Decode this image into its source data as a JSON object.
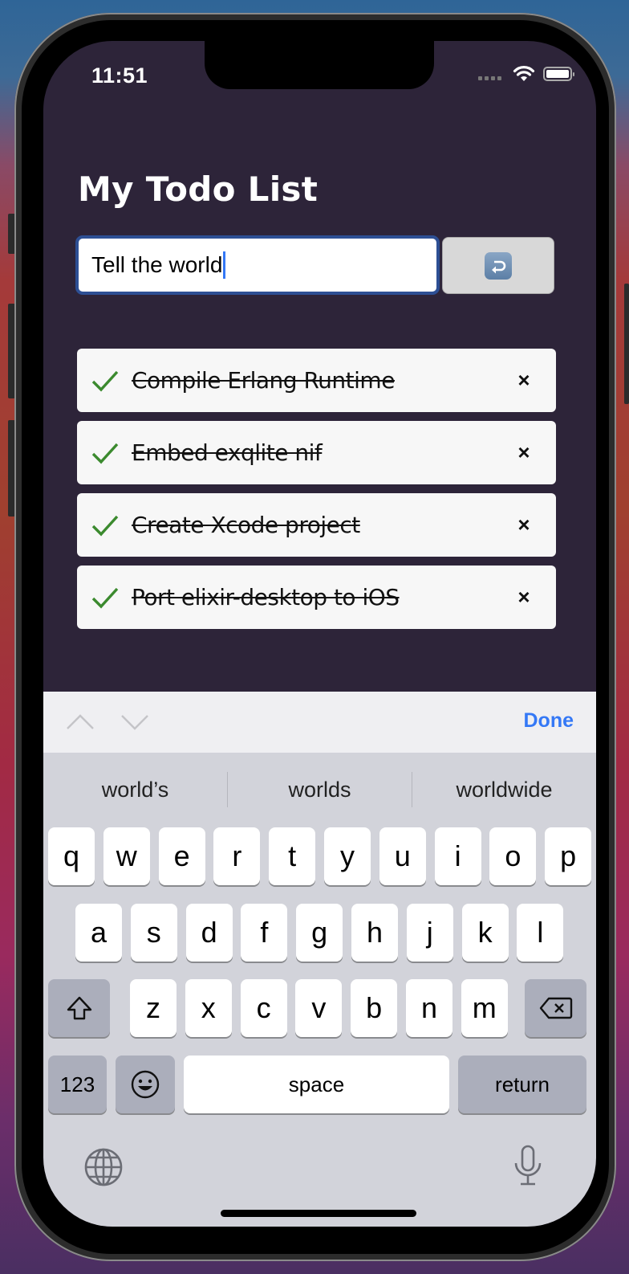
{
  "status_bar": {
    "time": "11:51",
    "icons": [
      "signal-dots-icon",
      "wifi-icon",
      "battery-icon"
    ]
  },
  "app": {
    "title": "My Todo List",
    "input": {
      "value": "Tell the world",
      "placeholder": ""
    },
    "submit_button": {
      "icon": "return-arrow-icon",
      "icon_glyph": "↩"
    },
    "todos": [
      {
        "text": "Compile Erlang Runtime",
        "done": true,
        "delete_glyph": "×"
      },
      {
        "text": "Embed exqlite nif",
        "done": true,
        "delete_glyph": "×"
      },
      {
        "text": "Create Xcode project",
        "done": true,
        "delete_glyph": "×"
      },
      {
        "text": "Port elixir-desktop to iOS",
        "done": true,
        "delete_glyph": "×"
      }
    ],
    "colors": {
      "background": "#2d2439",
      "check": "#3b8a2e",
      "input_border": "#2d4f94",
      "accent": "#3478f6"
    }
  },
  "keyboard_toolbar": {
    "done_label": "Done"
  },
  "keyboard": {
    "suggestions": [
      "world’s",
      "worlds",
      "worldwide"
    ],
    "row1": [
      "q",
      "w",
      "e",
      "r",
      "t",
      "y",
      "u",
      "i",
      "o",
      "p"
    ],
    "row2": [
      "a",
      "s",
      "d",
      "f",
      "g",
      "h",
      "j",
      "k",
      "l"
    ],
    "row3": [
      "z",
      "x",
      "c",
      "v",
      "b",
      "n",
      "m"
    ],
    "numbers_label": "123",
    "space_label": "space",
    "return_label": "return"
  }
}
